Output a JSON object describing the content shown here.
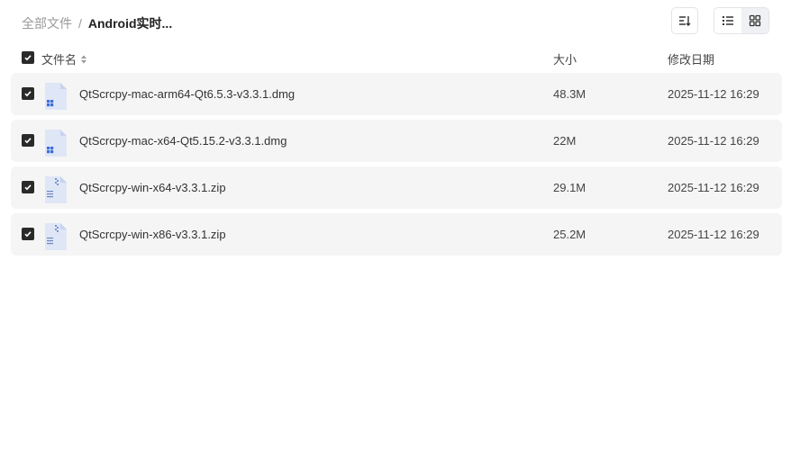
{
  "breadcrumb": {
    "root": "全部文件",
    "separator": "/",
    "current": "Android实时..."
  },
  "toolbar": {
    "sort_icon": "sort-icon",
    "list_view_icon": "list-view-icon",
    "grid_view_icon": "grid-view-icon"
  },
  "table": {
    "headers": {
      "name": "文件名",
      "size": "大小",
      "modified": "修改日期"
    },
    "rows": [
      {
        "name": "QtScrcpy-mac-arm64-Qt6.5.3-v3.3.1.dmg",
        "size": "48.3M",
        "modified": "2025-11-12 16:29",
        "icon": "dmg-file-icon",
        "checked": true
      },
      {
        "name": "QtScrcpy-mac-x64-Qt5.15.2-v3.3.1.dmg",
        "size": "22M",
        "modified": "2025-11-12 16:29",
        "icon": "dmg-file-icon",
        "checked": true
      },
      {
        "name": "QtScrcpy-win-x64-v3.3.1.zip",
        "size": "29.1M",
        "modified": "2025-11-12 16:29",
        "icon": "zip-file-icon",
        "checked": true
      },
      {
        "name": "QtScrcpy-win-x86-v3.3.1.zip",
        "size": "25.2M",
        "modified": "2025-11-12 16:29",
        "icon": "zip-file-icon",
        "checked": true
      }
    ]
  },
  "colors": {
    "checkbox": "#2a2a2a",
    "row_background": "#f5f5f6",
    "icon_blue": "#3b6ed8",
    "icon_paper": "#dfe6f6"
  }
}
